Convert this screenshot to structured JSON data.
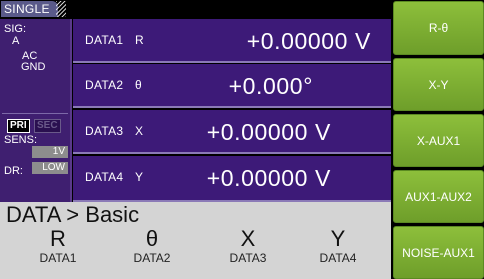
{
  "mode_tab": "SINGLE",
  "status": {
    "sig_label": "SIG:",
    "sig_value": "A",
    "coupling": "AC",
    "ground": "GND",
    "pri": "PRI",
    "sec": "SEC",
    "sens_label": "SENS:",
    "sens_value": "1V",
    "dr_label": "DR:",
    "dr_value": "LOW"
  },
  "data_rows": [
    {
      "label": "DATA1",
      "symbol": "R",
      "value": "+0.00000  V"
    },
    {
      "label": "DATA2",
      "symbol": "θ",
      "value": "+0.000°"
    },
    {
      "label": "DATA3",
      "symbol": "X",
      "value": "+0.00000  V"
    },
    {
      "label": "DATA4",
      "symbol": "Y",
      "value": "+0.00000  V"
    }
  ],
  "breadcrumb": "DATA > Basic",
  "bottom_columns": [
    {
      "symbol": "R",
      "label": "DATA1"
    },
    {
      "symbol": "θ",
      "label": "DATA2"
    },
    {
      "symbol": "X",
      "label": "DATA3"
    },
    {
      "symbol": "Y",
      "label": "DATA4"
    }
  ],
  "side_buttons": [
    "R-θ",
    "X-Y",
    "X-AUX1",
    "AUX1-AUX2",
    "NOISE-AUX1"
  ],
  "colors": {
    "panel": "#3d1a78",
    "button_green": "#7fb236",
    "bottom_bg": "#d4d4d4"
  }
}
